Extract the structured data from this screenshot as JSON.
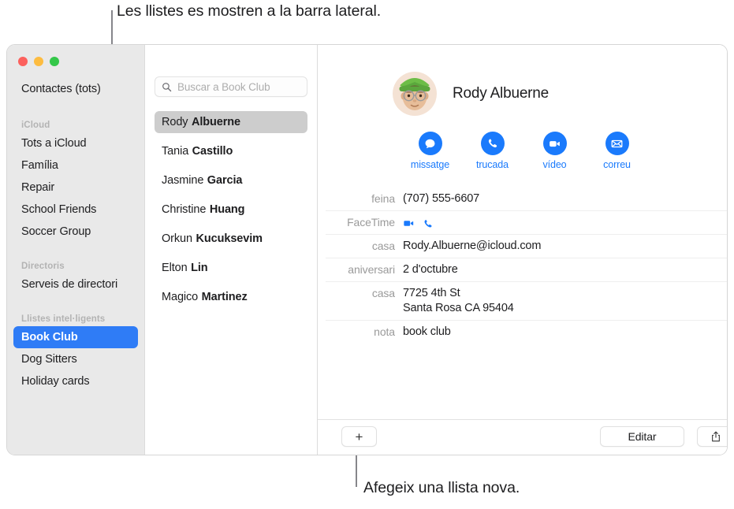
{
  "annotations": {
    "top": "Les llistes es mostren a la barra lateral.",
    "bottom": "Afegeix una llista nova."
  },
  "window": {
    "traffic_lights": [
      "close",
      "minimize",
      "zoom"
    ],
    "colors": {
      "accent_blue": "#1a7afc",
      "selection_blue": "#2f7cf6",
      "list_selection_gray": "#cdcdcd",
      "sidebar_bg": "#e9e9e9"
    }
  },
  "sidebar": {
    "all_contacts": "Contactes (tots)",
    "groups": [
      {
        "header": "iCloud",
        "items": [
          {
            "label": "Tots a iCloud",
            "selected": false
          },
          {
            "label": "Família",
            "selected": false
          },
          {
            "label": "Repair",
            "selected": false
          },
          {
            "label": "School Friends",
            "selected": false
          },
          {
            "label": "Soccer Group",
            "selected": false
          }
        ]
      },
      {
        "header": "Directoris",
        "items": [
          {
            "label": "Serveis de directori",
            "selected": false
          }
        ]
      },
      {
        "header": "Llistes intel·ligents",
        "items": [
          {
            "label": "Book Club",
            "selected": true
          },
          {
            "label": "Dog Sitters",
            "selected": false
          },
          {
            "label": "Holiday cards",
            "selected": false
          }
        ]
      }
    ]
  },
  "list": {
    "search_placeholder": "Buscar a Book Club",
    "contacts": [
      {
        "first": "Rody",
        "last": "Albuerne",
        "selected": true
      },
      {
        "first": "Tania",
        "last": "Castillo",
        "selected": false
      },
      {
        "first": "Jasmine",
        "last": "Garcia",
        "selected": false
      },
      {
        "first": "Christine",
        "last": "Huang",
        "selected": false
      },
      {
        "first": "Orkun",
        "last": "Kucuksevim",
        "selected": false
      },
      {
        "first": "Elton",
        "last": "Lin",
        "selected": false
      },
      {
        "first": "Magico",
        "last": "Martinez",
        "selected": false
      }
    ]
  },
  "detail": {
    "name": "Rody Albuerne",
    "actions": [
      {
        "icon": "message-icon",
        "label": "missatge"
      },
      {
        "icon": "phone-icon",
        "label": "trucada"
      },
      {
        "icon": "video-icon",
        "label": "vídeo"
      },
      {
        "icon": "mail-icon",
        "label": "correu"
      }
    ],
    "fields": [
      {
        "label": "feina",
        "value": "(707) 555-6607",
        "type": "text"
      },
      {
        "label": "FaceTime",
        "value": "",
        "type": "facetime"
      },
      {
        "label": "casa",
        "value": "Rody.Albuerne@icloud.com",
        "type": "text"
      },
      {
        "label": "aniversari",
        "value": "2 d'octubre",
        "type": "text"
      },
      {
        "label": "casa",
        "value": "7725 4th St",
        "value2": "Santa Rosa CA 95404",
        "type": "multiline"
      },
      {
        "label": "nota",
        "value": "book club",
        "type": "text"
      }
    ]
  },
  "bottom_bar": {
    "add_label": "+",
    "edit_label": "Editar",
    "share_icon": "share-icon"
  }
}
